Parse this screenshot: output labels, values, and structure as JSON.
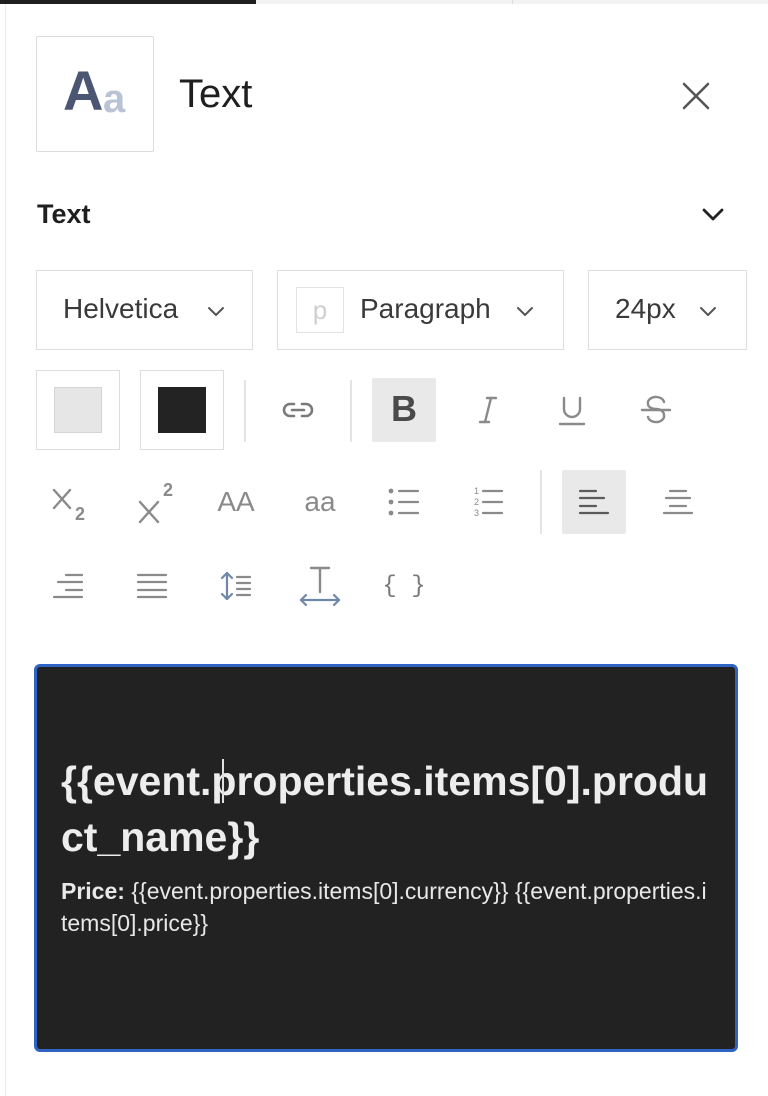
{
  "panel": {
    "title": "Text",
    "icon": {
      "big_letter": "A",
      "small_letter": "a",
      "name": "text-block-icon"
    }
  },
  "section": {
    "title": "Text",
    "expanded": true
  },
  "toolbar": {
    "font_family": "Helvetica",
    "block_type": "Paragraph",
    "block_type_icon": "p",
    "font_size": "24px",
    "background_color": "#e6e6e6",
    "text_color": "#232323",
    "case_upper_label": "AA",
    "case_lower_label": "aa",
    "variable_label": "{ }",
    "active_tools": [
      "bold",
      "align-left"
    ]
  },
  "editor": {
    "heading": "{{event.properties.items[0].product_name}}",
    "price_label": "Price:",
    "price_value": " {{event.properties.items[0].currency}} {{event.properties.items[0].price}}",
    "background": "#222222",
    "border_color": "#2f63c4"
  }
}
